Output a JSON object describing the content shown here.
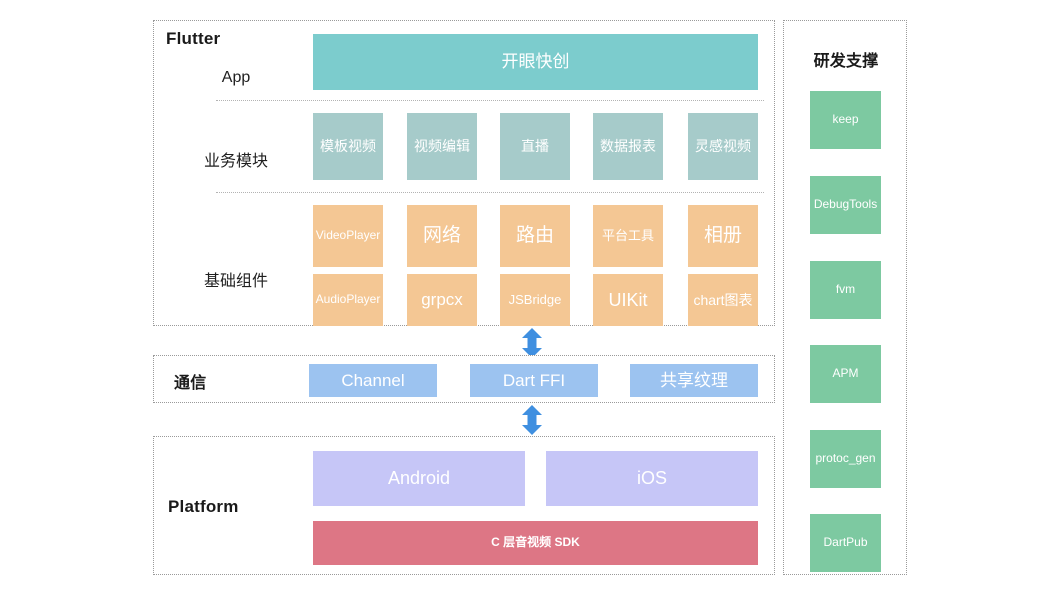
{
  "diagram": {
    "flutter": {
      "title": "Flutter",
      "rows": [
        {
          "label": "App",
          "label_kind": "latin",
          "blocks": [
            {
              "text": "开眼快创"
            }
          ]
        },
        {
          "label": "业务模块",
          "label_kind": "cn",
          "blocks": [
            {
              "text": "模板视频"
            },
            {
              "text": "视频编辑"
            },
            {
              "text": "直播"
            },
            {
              "text": "数据报表"
            },
            {
              "text": "灵感视频"
            }
          ]
        },
        {
          "label": "基础组件",
          "label_kind": "cn",
          "blocks_row1": [
            {
              "text": "VideoPlayer",
              "size": "small"
            },
            {
              "text": "网络",
              "size": "large"
            },
            {
              "text": "路由",
              "size": "large"
            },
            {
              "text": "平台工具",
              "size": "small"
            },
            {
              "text": "相册",
              "size": "large"
            }
          ],
          "blocks_row2": [
            {
              "text": "AudioPlayer",
              "size": "small"
            },
            {
              "text": "grpcx",
              "size": "large"
            },
            {
              "text": "JSBridge",
              "size": "small"
            },
            {
              "text": "UIKit",
              "size": "large"
            },
            {
              "text": "chart图表",
              "size": "medium"
            }
          ]
        }
      ]
    },
    "communication": {
      "title": "通信",
      "blocks": [
        {
          "text": "Channel"
        },
        {
          "text": "Dart FFI"
        },
        {
          "text": "共享纹理"
        }
      ]
    },
    "platform": {
      "title": "Platform",
      "os_blocks": [
        {
          "text": "Android"
        },
        {
          "text": "iOS"
        }
      ],
      "sdk_block": {
        "text": "C 层音视频 SDK"
      }
    },
    "devops": {
      "title": "研发支撑",
      "items": [
        {
          "text": "keep"
        },
        {
          "text": "DebugTools"
        },
        {
          "text": "fvm"
        },
        {
          "text": "APM"
        },
        {
          "text": "protoc_gen"
        },
        {
          "text": "DartPub"
        }
      ]
    },
    "connectors": [
      {
        "name": "flutter-to-communication",
        "direction": "bidirectional"
      },
      {
        "name": "communication-to-platform",
        "direction": "bidirectional"
      }
    ],
    "colors": {
      "app": "#7ccccd",
      "business": "#a6cbca",
      "base_component": "#f4c794",
      "communication": "#9cc3f0",
      "platform": "#c6c6f7",
      "sdk": "#dd7685",
      "devops": "#7dc9a1",
      "arrow": "#3f8fe0",
      "panel_border": "#9a9a9a",
      "background": "#ffffff"
    }
  }
}
